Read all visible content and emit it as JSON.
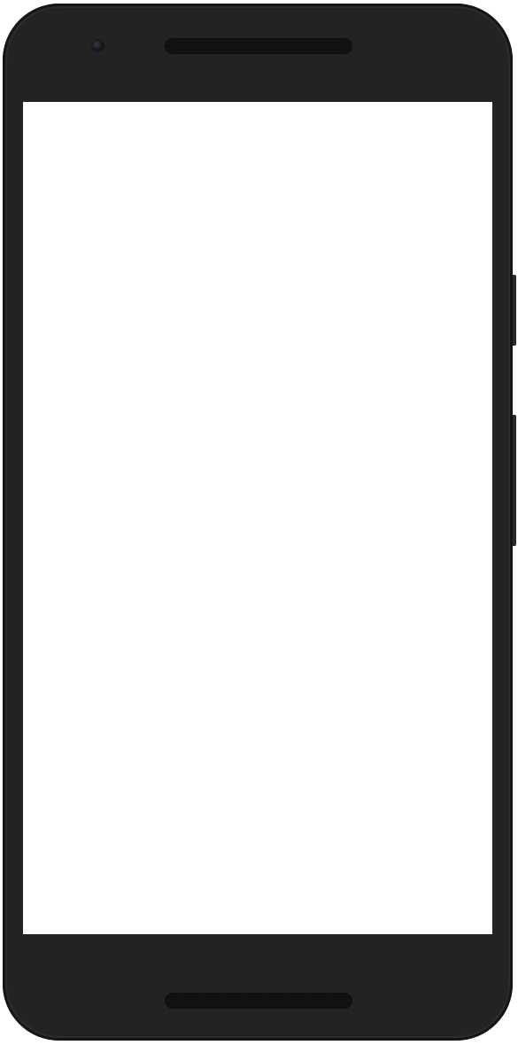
{
  "device": {
    "type": "smartphone",
    "frame_color": "#232323",
    "screen_color": "#ffffff",
    "icons": {
      "camera": "front-camera-icon",
      "speaker_top": "earpiece-speaker-icon",
      "speaker_bottom": "bottom-speaker-icon"
    }
  },
  "screen": {
    "content": []
  }
}
